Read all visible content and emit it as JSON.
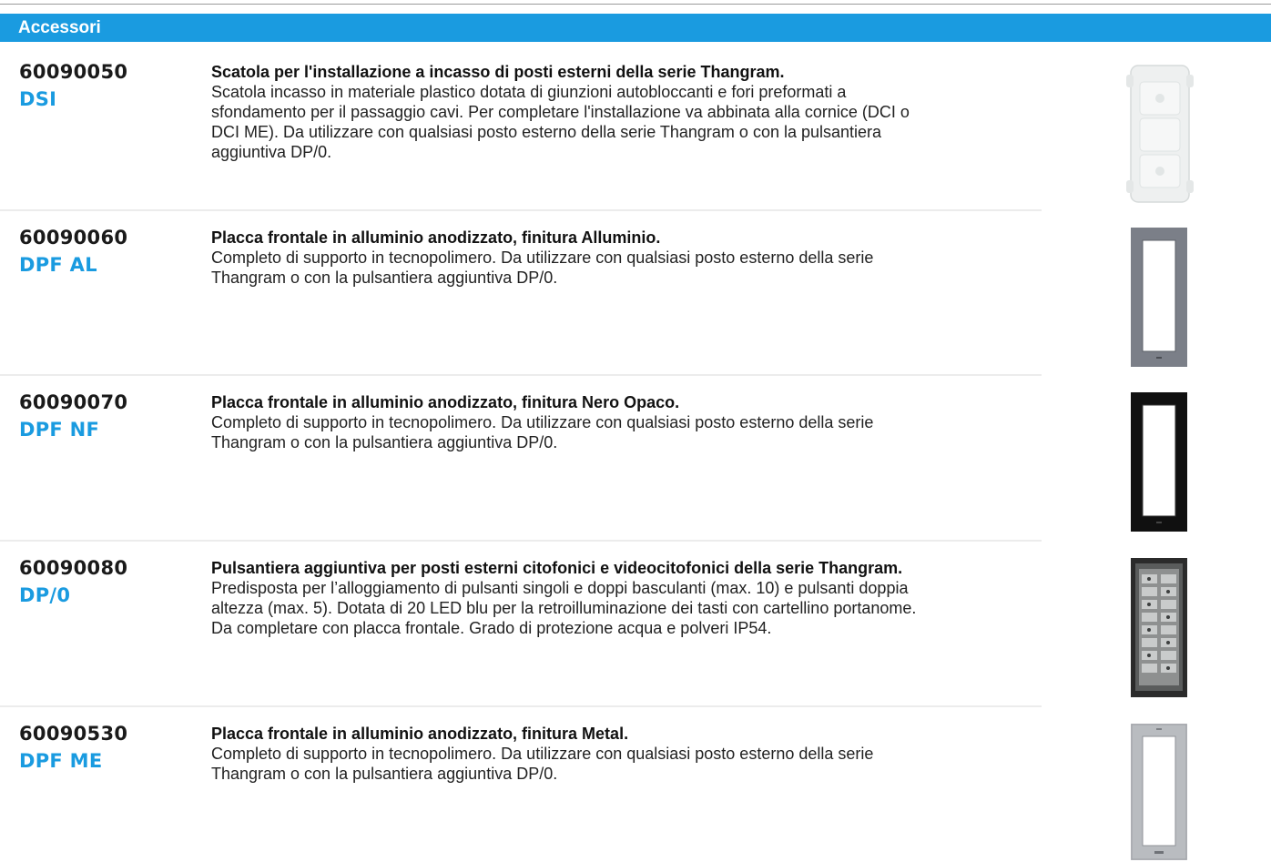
{
  "section": {
    "title": "Accessori"
  },
  "items": [
    {
      "code": "60090050",
      "name": "DSI",
      "title": "Scatola per l'installazione a incasso di posti esterni della serie Thangram.",
      "description": "Scatola incasso in materiale plastico dotata di giunzioni autobloccanti e fori preformati a sfondamento per il passaggio cavi. Per completare l'installazione va abbinata alla cornice (DCI o DCI ME). Da utilizzare con qualsiasi posto esterno della serie Thangram o con la pulsantiera aggiuntiva DP/0."
    },
    {
      "code": "60090060",
      "name": "DPF AL",
      "title": "Placca frontale in alluminio anodizzato, finitura Alluminio.",
      "description": "Completo di supporto in tecnopolimero. Da utilizzare con qualsiasi posto esterno della serie Thangram o con la pulsantiera aggiuntiva DP/0."
    },
    {
      "code": "60090070",
      "name": "DPF NF",
      "title": "Placca frontale in alluminio anodizzato, finitura Nero Opaco.",
      "description": "Completo di supporto in tecnopolimero. Da utilizzare con qualsiasi posto esterno della serie Thangram o con la pulsantiera aggiuntiva DP/0."
    },
    {
      "code": "60090080",
      "name": "DP/0",
      "title": "Pulsantiera aggiuntiva per posti esterni citofonici e videocitofonici della serie Thangram.",
      "description": "Predisposta per l’alloggiamento di pulsanti singoli e doppi basculanti (max. 10) e pulsanti doppia altezza (max. 5). Dotata di 20 LED blu per la retroilluminazione dei tasti con cartellino portanome. Da completare con placca frontale. Grado di protezione acqua e polveri IP54."
    },
    {
      "code": "60090530",
      "name": "DPF ME",
      "title": "Placca frontale in alluminio anodizzato, finitura Metal.",
      "description": "Completo di supporto in tecnopolimero. Da utilizzare con qualsiasi posto esterno della serie Thangram o con la pulsantiera aggiuntiva DP/0."
    }
  ]
}
